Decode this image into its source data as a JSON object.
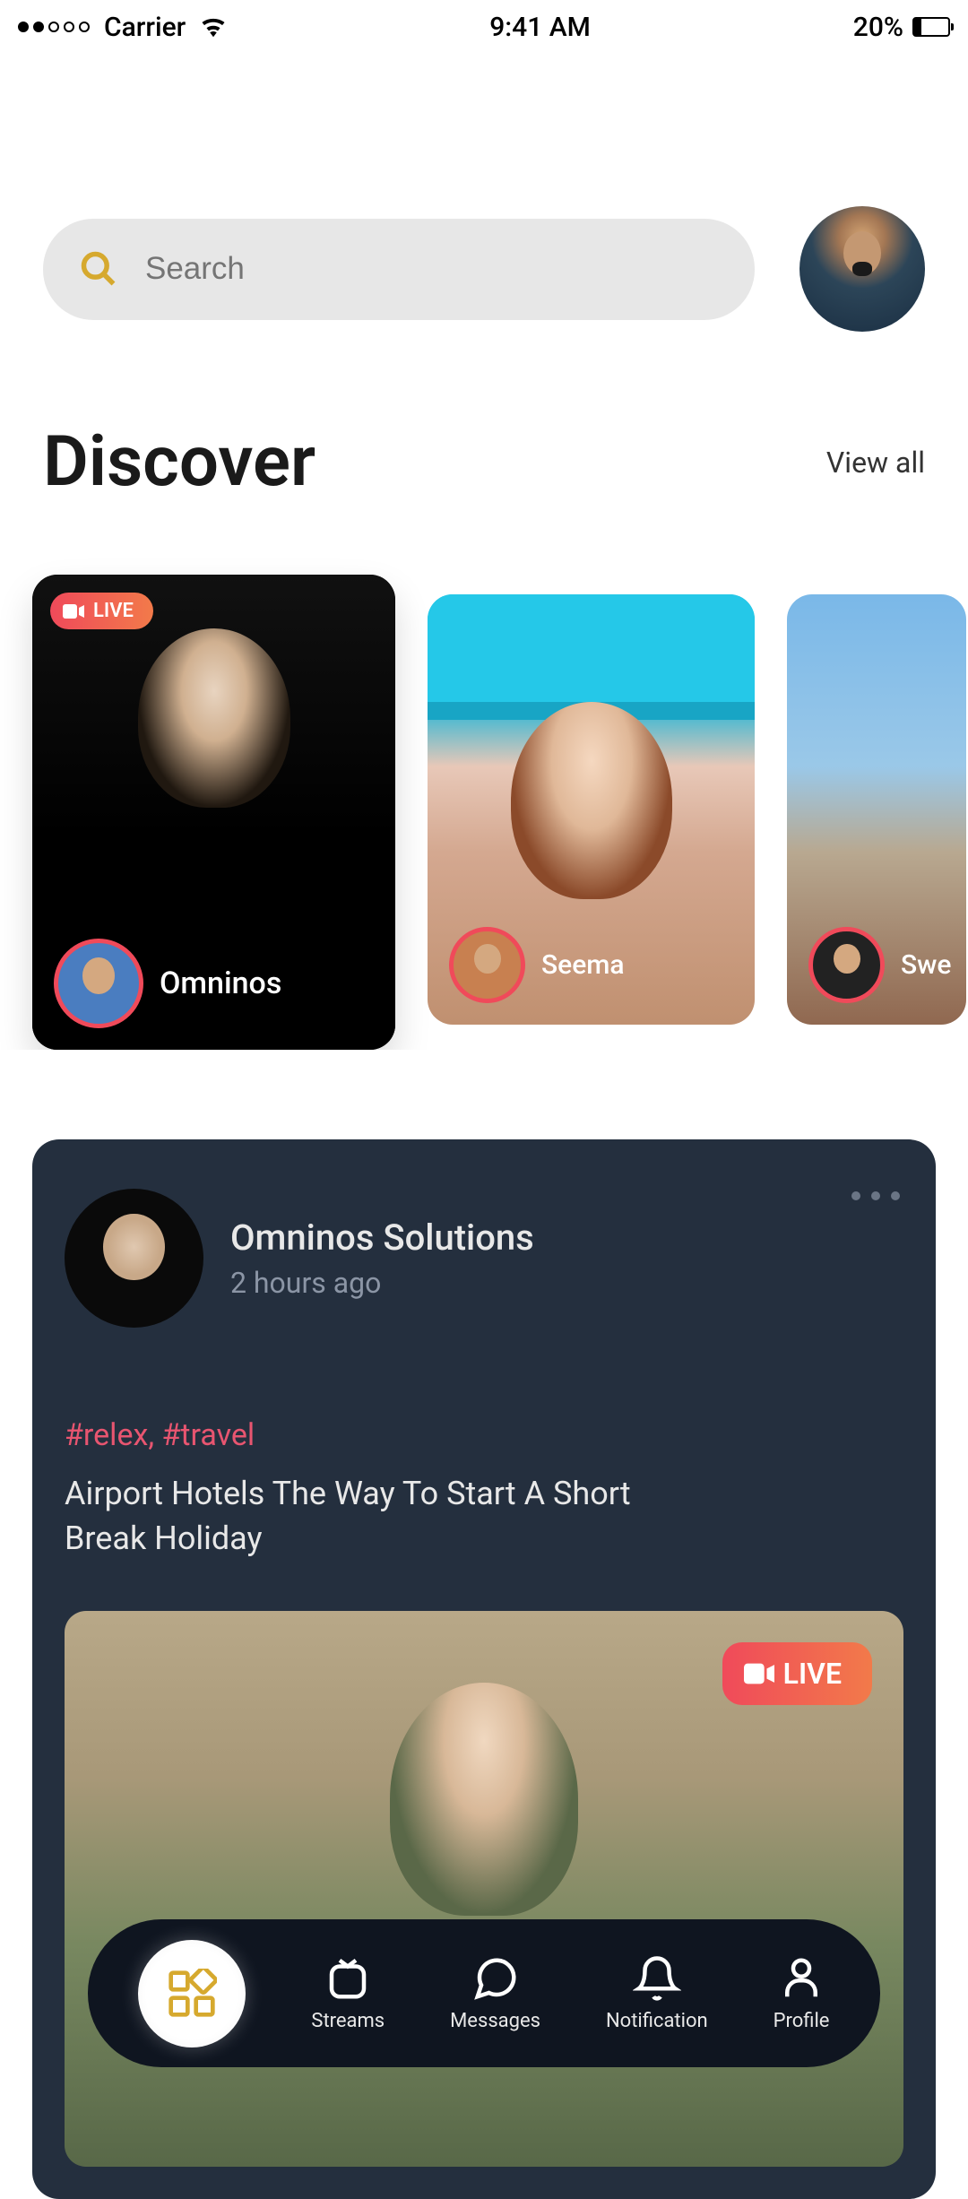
{
  "statusbar": {
    "carrier": "Carrier",
    "time": "9:41 AM",
    "battery_text": "20%"
  },
  "search": {
    "placeholder": "Search"
  },
  "discover": {
    "title": "Discover",
    "view_all": "View all",
    "live_badge": "LIVE",
    "cards": [
      {
        "name": "Omninos",
        "live": true
      },
      {
        "name": "Seema",
        "live": false
      },
      {
        "name": "Swe",
        "live": false
      }
    ]
  },
  "feed": {
    "author": "Omninos Solutions",
    "timestamp": "2 hours ago",
    "tags": "#relex, #travel",
    "title": "Airport Hotels The Way To Start A Short Break Holiday",
    "live_badge": "LIVE"
  },
  "nav": {
    "streams": "Streams",
    "messages": "Messages",
    "notification": "Notification",
    "profile": "Profile"
  }
}
